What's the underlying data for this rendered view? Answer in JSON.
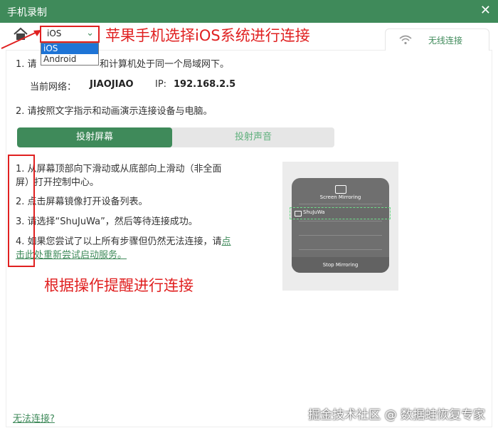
{
  "window": {
    "title": "手机录制",
    "close_glyph": "✕"
  },
  "top": {
    "os_select": {
      "value": "iOS",
      "options": [
        "iOS",
        "Android"
      ]
    },
    "annotation": "苹果手机选择iOS系统进行连接",
    "wifi_tab_label": "无线连接"
  },
  "info": {
    "line1_prefix": "1. 请",
    "line1_suffix": "和计算机处于同一个局域网下。",
    "network_label": "当前网络：",
    "network_name": "JIAOJIAO",
    "ip_label": "IP:",
    "ip_value": "192.168.2.5",
    "line2": "2. 请按照文字指示和动画演示连接设备与电脑。"
  },
  "tabs": {
    "active": "投射屏幕",
    "inactive": "投射声音"
  },
  "steps": {
    "s1a": "1. 从屏幕顶部向下滑动或从底部向上滑动（非全面",
    "s1b": "屏）打开控制中心。",
    "s2": "2. 点击屏幕镜像打开设备列表。",
    "s3": "3. 请选择“ShuJuWa”，然后等待连接成功。",
    "s4a": "4. 如果您尝试了以上所有步骤但仍然无法连接，请",
    "s4_link_a": "点",
    "s4_link_b": "击此处重新尝试启动服务。"
  },
  "annotation_bottom": "根据操作提醒进行连接",
  "phone": {
    "heading": "Screen Mirroring",
    "device": "ShuJuWa",
    "stop": "Stop Mirroring"
  },
  "footer": {
    "cannot_connect": "无法连接?",
    "watermark": "掘金技术社区 @ 数据蛙恢复专家"
  },
  "colors": {
    "brand_green": "#3f8a5a",
    "annotation_red": "#e02020",
    "selection_blue": "#1e74d6"
  }
}
